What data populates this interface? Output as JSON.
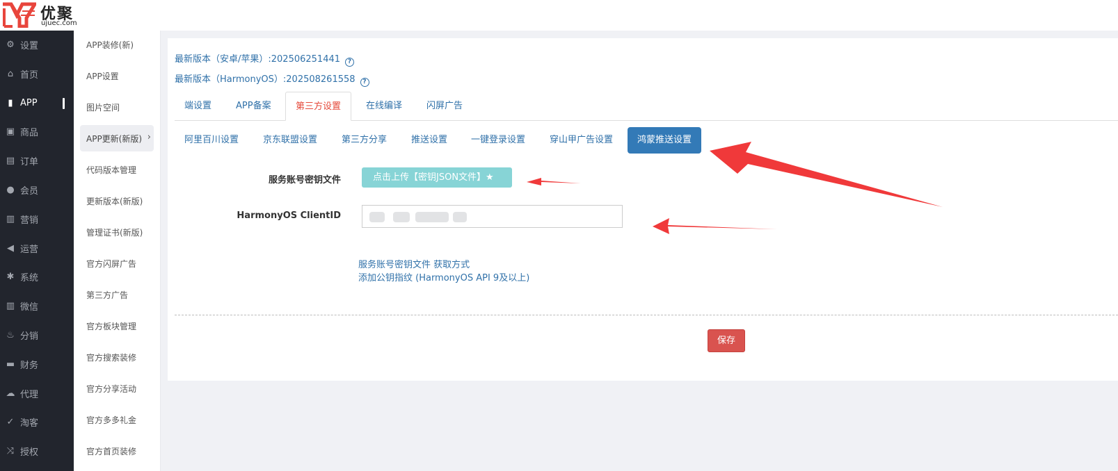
{
  "logo": {
    "cn": "优聚",
    "en": "ujuec.com"
  },
  "sidebar": {
    "items": [
      {
        "label": "设置",
        "icon": "gear-icon",
        "glyph": "⚙"
      },
      {
        "label": "首页",
        "icon": "home-icon",
        "glyph": "⌂"
      },
      {
        "label": "APP",
        "icon": "bookmark-icon",
        "glyph": "▮",
        "active": true
      },
      {
        "label": "商品",
        "icon": "gift-icon",
        "glyph": "▣"
      },
      {
        "label": "订单",
        "icon": "list-icon",
        "glyph": "▤"
      },
      {
        "label": "会员",
        "icon": "user-icon",
        "glyph": "●"
      },
      {
        "label": "营销",
        "icon": "bar-chart-icon",
        "glyph": "▥"
      },
      {
        "label": "运营",
        "icon": "megaphone-icon",
        "glyph": "◀"
      },
      {
        "label": "系统",
        "icon": "asterisk-icon",
        "glyph": "✱"
      },
      {
        "label": "微信",
        "icon": "signal-icon",
        "glyph": "▥"
      },
      {
        "label": "分销",
        "icon": "fire-icon",
        "glyph": "♨"
      },
      {
        "label": "财务",
        "icon": "briefcase-icon",
        "glyph": "▬"
      },
      {
        "label": "代理",
        "icon": "cloud-icon",
        "glyph": "☁"
      },
      {
        "label": "淘客",
        "icon": "check-icon",
        "glyph": "✓"
      },
      {
        "label": "授权",
        "icon": "shuffle-icon",
        "glyph": "⤨"
      }
    ]
  },
  "subnav": {
    "items": [
      {
        "label": "APP装修(新)"
      },
      {
        "label": "APP设置"
      },
      {
        "label": "图片空间"
      },
      {
        "label": "APP更新(新版)",
        "active": true
      },
      {
        "label": "代码版本管理"
      },
      {
        "label": "更新版本(新版)"
      },
      {
        "label": "管理证书(新版)"
      },
      {
        "label": "官方闪屏广告"
      },
      {
        "label": "第三方广告"
      },
      {
        "label": "官方板块管理"
      },
      {
        "label": "官方搜索装修"
      },
      {
        "label": "官方分享活动"
      },
      {
        "label": "官方多多礼金"
      },
      {
        "label": "官方首页装修"
      }
    ]
  },
  "versions": {
    "android_ios": "最新版本（安卓/苹果）:202506251441",
    "harmony": "最新版本（HarmonyOS）:202508261558",
    "help_glyph": "?"
  },
  "tabs": [
    "端设置",
    "APP备案",
    "第三方设置",
    "在线编译",
    "闪屏广告"
  ],
  "active_tab": 2,
  "subtabs": [
    "阿里百川设置",
    "京东联盟设置",
    "第三方分享",
    "推送设置",
    "一键登录设置",
    "穿山甲广告设置",
    "鸿蒙推送设置"
  ],
  "active_subtab": 6,
  "form": {
    "key_file_label": "服务账号密钥文件",
    "upload_button": "点击上传【密钥JSON文件】★",
    "client_id_label": "HarmonyOS ClientID",
    "client_id_value": ""
  },
  "links": {
    "how_to_get": "服务账号密钥文件 获取方式",
    "add_fingerprint": "添加公钥指纹 (HarmonyOS API 9及以上)"
  },
  "save_button": "保存",
  "colors": {
    "accent": "#337ab7",
    "link": "#3071a9",
    "active_tab": "#e5493a",
    "save": "#d9534f",
    "upload": "#87d4d6",
    "arrow": "#f0393a",
    "sidebar_bg": "#22252d"
  }
}
